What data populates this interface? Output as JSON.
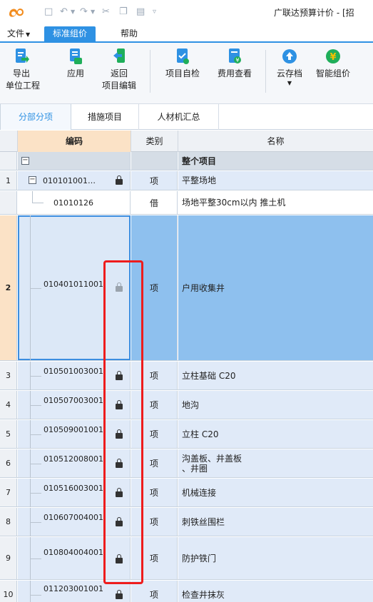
{
  "app": {
    "window_title": "广联达预算计价 - [招",
    "quick_access_icons": [
      "save-icon",
      "undo-icon",
      "redo-icon",
      "cut-icon",
      "copy-icon",
      "paste-icon",
      "customize-icon"
    ]
  },
  "menus": [
    {
      "label": "文件",
      "has_caret": true,
      "active": false
    },
    {
      "label": "标准组价",
      "has_caret": false,
      "active": true
    },
    {
      "label": "帮助",
      "has_caret": false,
      "active": false
    }
  ],
  "ribbon": [
    {
      "label": "导出\n单位工程",
      "icon": "export-icon"
    },
    {
      "label": "应用",
      "icon": "apply-icon"
    },
    {
      "label": "返回\n项目编辑",
      "icon": "return-icon"
    },
    {
      "label": "项目自检",
      "icon": "self-check-icon"
    },
    {
      "label": "费用查看",
      "icon": "cost-view-icon"
    },
    {
      "label": "云存档",
      "icon": "cloud-archive-icon",
      "has_dropdown": true
    },
    {
      "label": "智能组价",
      "icon": "smart-pricing-icon"
    }
  ],
  "tabs": [
    {
      "label": "分部分项",
      "active": true
    },
    {
      "label": "措施项目",
      "active": false
    },
    {
      "label": "人材机汇总",
      "active": false
    }
  ],
  "grid": {
    "headers": {
      "code": "编码",
      "type": "类别",
      "name": "名称"
    },
    "rows": [
      {
        "num": "",
        "code": "",
        "type": "",
        "name": "整个项目",
        "kind": "total",
        "expander": "−",
        "lock": false
      },
      {
        "num": "1",
        "code": "010101001…",
        "type": "项",
        "name": "平整场地",
        "kind": "item",
        "expander": "−",
        "lock": true
      },
      {
        "num": "",
        "code": "01010126",
        "type": "借",
        "name": "场地平整30cm以内 推土机",
        "kind": "sub",
        "lock": false
      },
      {
        "num": "2",
        "code": "010401011001",
        "type": "项",
        "name": "户用收集井",
        "kind": "selected",
        "lock": true
      },
      {
        "num": "3",
        "code": "010501003001",
        "type": "项",
        "name": "立柱基础 C20",
        "kind": "item",
        "lock": true
      },
      {
        "num": "4",
        "code": "010507003001",
        "type": "项",
        "name": "地沟",
        "kind": "item",
        "lock": true
      },
      {
        "num": "5",
        "code": "010509001001",
        "type": "项",
        "name": "立柱 C20",
        "kind": "item",
        "lock": true
      },
      {
        "num": "6",
        "code": "010512008001",
        "type": "项",
        "name": "沟盖板、井盖板\n、井圈",
        "kind": "item",
        "lock": true
      },
      {
        "num": "7",
        "code": "010516003001",
        "type": "项",
        "name": "机械连接",
        "kind": "item",
        "lock": true
      },
      {
        "num": "8",
        "code": "010607004001",
        "type": "项",
        "name": "刺铁丝围栏",
        "kind": "item",
        "lock": true
      },
      {
        "num": "9",
        "code": "010804004001",
        "type": "项",
        "name": "防护铁门",
        "kind": "item",
        "lock": true
      },
      {
        "num": "10",
        "code": "011203001001",
        "type": "项",
        "name": "检查井抹灰",
        "kind": "item",
        "lock": true
      }
    ]
  },
  "colors": {
    "accent": "#2e91e3",
    "highlight_box": "#ee1c1c",
    "selected_row": "#8ec0ee"
  }
}
